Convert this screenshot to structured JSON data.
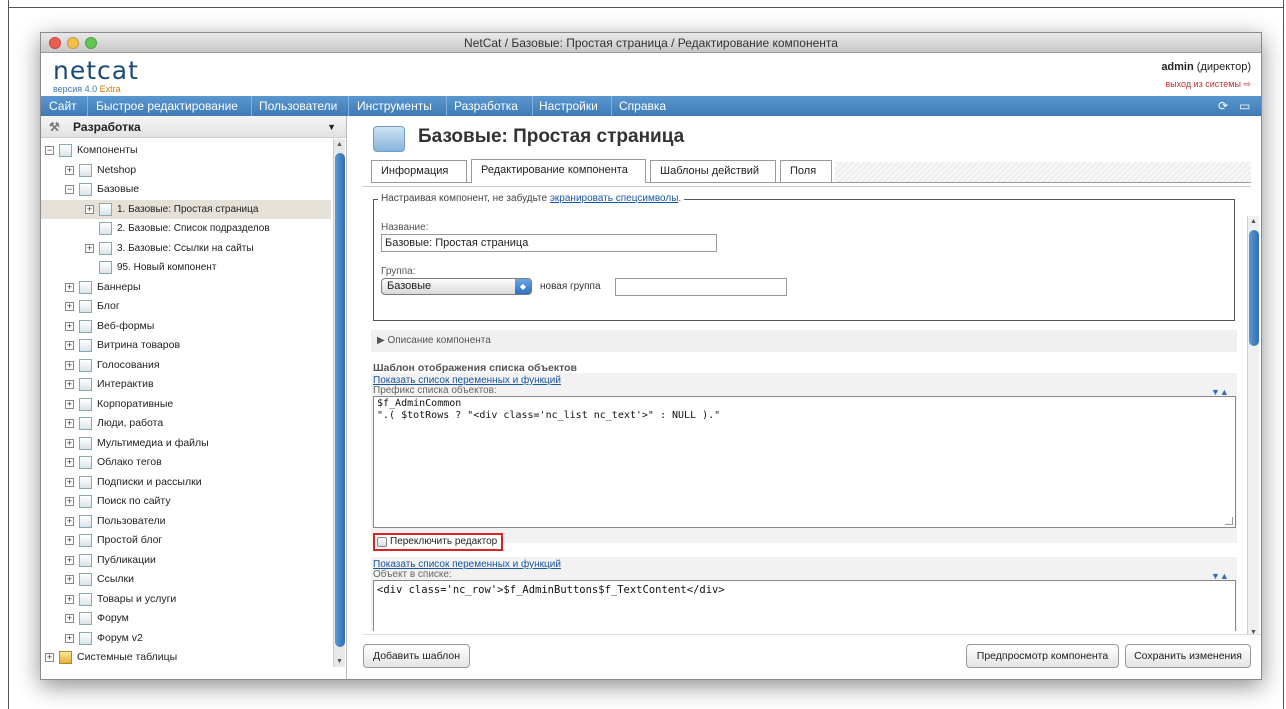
{
  "window": {
    "title": "NetCat / Базовые: Простая страница / Редактирование компонента"
  },
  "header": {
    "logo": "netcat",
    "version_prefix": "версия 4.0",
    "version_edition": "Extra",
    "user_name": "admin",
    "user_role": "(директор)",
    "logout": "выход из системы"
  },
  "menu": {
    "items": [
      "Сайт",
      "Быстрое редактирование",
      "Пользователи",
      "Инструменты",
      "Разработка",
      "Настройки",
      "Справка"
    ]
  },
  "sidebar": {
    "title": "Разработка",
    "tree": [
      {
        "label": "Компоненты",
        "level": 0,
        "toggle": "−"
      },
      {
        "label": "Netshop",
        "level": 1,
        "toggle": "+"
      },
      {
        "label": "Базовые",
        "level": 1,
        "toggle": "−"
      },
      {
        "label": "1. Базовые: Простая страница",
        "level": 2,
        "toggle": "+",
        "selected": true
      },
      {
        "label": "2. Базовые: Список подразделов",
        "level": 2,
        "toggle": ""
      },
      {
        "label": "3. Базовые: Ссылки на сайты",
        "level": 2,
        "toggle": "+"
      },
      {
        "label": "95. Новый компонент",
        "level": 2,
        "toggle": ""
      },
      {
        "label": "Баннеры",
        "level": 1,
        "toggle": "+"
      },
      {
        "label": "Блог",
        "level": 1,
        "toggle": "+"
      },
      {
        "label": "Веб-формы",
        "level": 1,
        "toggle": "+"
      },
      {
        "label": "Витрина товаров",
        "level": 1,
        "toggle": "+"
      },
      {
        "label": "Голосования",
        "level": 1,
        "toggle": "+"
      },
      {
        "label": "Интерактив",
        "level": 1,
        "toggle": "+"
      },
      {
        "label": "Корпоративные",
        "level": 1,
        "toggle": "+"
      },
      {
        "label": "Люди, работа",
        "level": 1,
        "toggle": "+"
      },
      {
        "label": "Мультимедиа и файлы",
        "level": 1,
        "toggle": "+"
      },
      {
        "label": "Облако тегов",
        "level": 1,
        "toggle": "+"
      },
      {
        "label": "Подписки и рассылки",
        "level": 1,
        "toggle": "+"
      },
      {
        "label": "Поиск по сайту",
        "level": 1,
        "toggle": "+"
      },
      {
        "label": "Пользователи",
        "level": 1,
        "toggle": "+"
      },
      {
        "label": "Простой блог",
        "level": 1,
        "toggle": "+"
      },
      {
        "label": "Публикации",
        "level": 1,
        "toggle": "+"
      },
      {
        "label": "Ссылки",
        "level": 1,
        "toggle": "+"
      },
      {
        "label": "Товары и услуги",
        "level": 1,
        "toggle": "+"
      },
      {
        "label": "Форум",
        "level": 1,
        "toggle": "+"
      },
      {
        "label": "Форум v2",
        "level": 1,
        "toggle": "+"
      },
      {
        "label": "Системные таблицы",
        "level": 0,
        "toggle": "+"
      }
    ]
  },
  "main": {
    "page_title": "Базовые: Простая страница",
    "tabs": [
      "Информация",
      "Редактирование компонента",
      "Шаблоны действий",
      "Поля"
    ],
    "active_tab": "Редактирование компонента",
    "notice_text": "Настраивая компонент, не забудьте ",
    "notice_link": "экранировать спецсимволы",
    "notice_end": ".",
    "name_label": "Название:",
    "name_value": "Базовые: Простая страница",
    "group_label": "Группа:",
    "group_value": "Базовые",
    "new_group_label": "новая группа",
    "new_group_value": "",
    "description_toggle": "Описание компонента",
    "section_title": "Шаблон отображения списка объектов",
    "show_vars_link": "Показать список переменных и функций",
    "prefix_label": "Префикс списка объектов:",
    "prefix_code": "$f_AdminCommon\n\".( $totRows ? \"<div class='nc_list nc_text'>\" : NULL ).\"",
    "toggle_editor": "Переключить редактор",
    "show_vars_link2": "Показать список переменных и функций",
    "object_label": "Объект в списке:",
    "object_code": "<div class='nc_row'>$f_AdminButtons$f_TextContent</div>",
    "arrows": "▼▲"
  },
  "footer": {
    "add_template": "Добавить шаблон",
    "preview": "Предпросмотр компонента",
    "save": "Сохранить изменения"
  }
}
